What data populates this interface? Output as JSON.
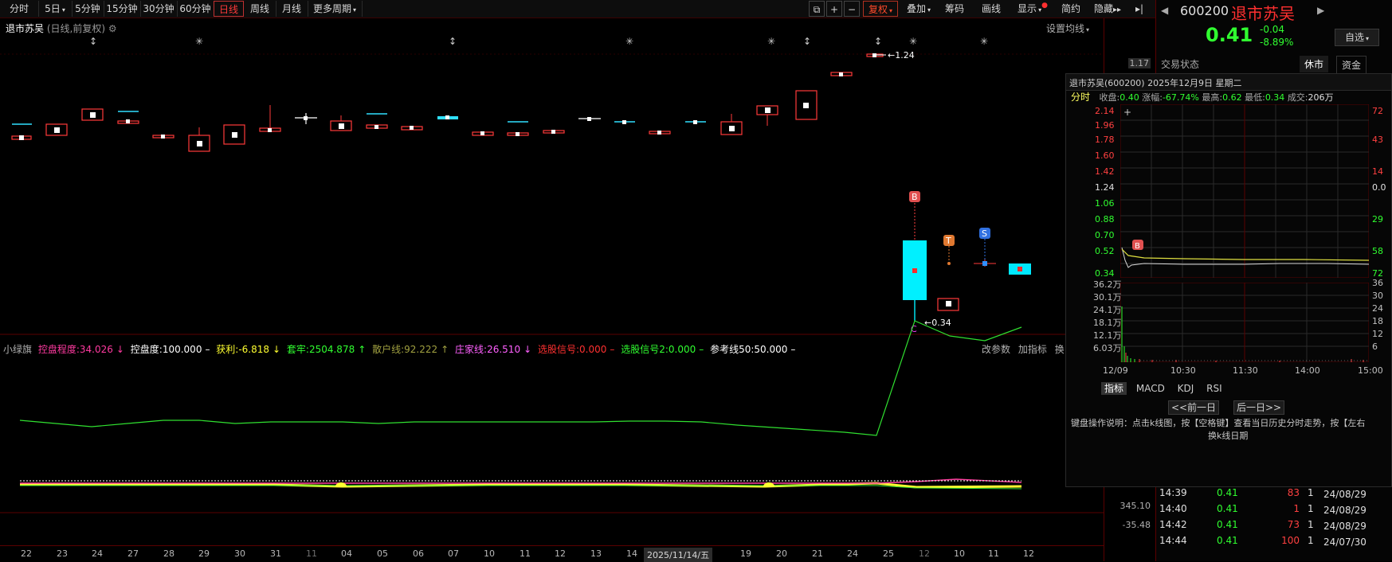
{
  "toolbar": {
    "left_items": [
      "分时",
      "5日",
      "5分钟",
      "15分钟",
      "30分钟",
      "60分钟",
      "日线",
      "周线",
      "月线",
      "更多周期"
    ],
    "right_items": [
      "复权",
      "叠加",
      "筹码",
      "画线",
      "显示",
      "简约",
      "隐藏"
    ],
    "icons": [
      "copy-window-icon",
      "plus-icon",
      "minus-icon"
    ]
  },
  "chart": {
    "stock_name": "退市苏吴",
    "subtitle": "(日线,前复权)",
    "settings_label": "设置均线",
    "price_tag_high": "1.24",
    "price_tag_low": "0.34",
    "axis_top": "1.17",
    "marker_b": "B",
    "marker_t": "T",
    "marker_s": "S",
    "marker_c": "C"
  },
  "indicator": {
    "name": "小绿旗",
    "items": [
      {
        "label": "控盘程度:34.026",
        "arrow": "↓",
        "color": "#ff3aa0"
      },
      {
        "label": "控盘度:100.000",
        "arrow": "–",
        "color": "#ffffff"
      },
      {
        "label": "获利:-6.818",
        "arrow": "↓",
        "color": "#ffff30"
      },
      {
        "label": "套牢:2504.878",
        "arrow": "↑",
        "color": "#30ff30"
      },
      {
        "label": "散户线:92.222",
        "arrow": "↑",
        "color": "#a0a040"
      },
      {
        "label": "庄家线:26.510",
        "arrow": "↓",
        "color": "#ff60ff"
      },
      {
        "label": "选股信号:0.000",
        "arrow": "–",
        "color": "#ff3030"
      },
      {
        "label": "选股信号2:0.000",
        "arrow": "–",
        "color": "#30ff30"
      },
      {
        "label": "参考线50:50.000",
        "arrow": "–",
        "color": "#ffffff"
      }
    ],
    "right_links": [
      "改参数",
      "加指标",
      "换"
    ],
    "axis_labels": [
      "345.10",
      "-35.48"
    ]
  },
  "dates": [
    "22",
    "23",
    "24",
    "27",
    "28",
    "29",
    "30",
    "31",
    "11",
    "04",
    "05",
    "06",
    "07",
    "10",
    "11",
    "12",
    "13",
    "14",
    "2025/11/14/五",
    "19",
    "20",
    "21",
    "24",
    "25",
    "12",
    "10",
    "11",
    "12"
  ],
  "quote": {
    "code": "600200",
    "name": "退市苏吴",
    "price": "0.41",
    "change": "-0.04",
    "change_pct": "-8.89%",
    "watch_label": "自选",
    "status_label": "交易状态",
    "status_value": "休市",
    "fund_label": "资金"
  },
  "popup": {
    "title": "退市苏吴(600200) 2025年12月9日 星期二",
    "tab": "分时",
    "close_label": "收盘:",
    "close_value": "0.40",
    "pct_label": "涨幅:",
    "pct_value": "-67.74%",
    "high_label": "最高:",
    "high_value": "0.62",
    "low_label": "最低:",
    "low_value": "0.34",
    "vol_label": "成交:",
    "vol_value": "206万",
    "y_left": [
      "2.14",
      "1.96",
      "1.78",
      "1.60",
      "1.42",
      "1.24",
      "1.06",
      "0.88",
      "0.70",
      "0.52",
      "0.34"
    ],
    "y_right": [
      "72",
      "58",
      "43",
      "29",
      "14",
      "0.0",
      "14",
      "29",
      "43",
      "58",
      "72"
    ],
    "vol_left": [
      "36.2万",
      "30.1万",
      "24.1万",
      "18.1万",
      "12.1万",
      "6.03万"
    ],
    "vol_right": [
      "36",
      "30",
      "24",
      "18",
      "12",
      "6"
    ],
    "x_labels": [
      "12/09",
      "10:30",
      "11:30",
      "14:00",
      "15:00"
    ],
    "sub_tabs": [
      "指标",
      "MACD",
      "KDJ",
      "RSI"
    ],
    "prev_btn": "<<前一日",
    "next_btn": "后一日>>",
    "help": "键盘操作说明：点击k线图，按【空格键】查看当日历史分时走势，按【左右",
    "help2": "换k线日期"
  },
  "ticks": [
    {
      "time": "14:39",
      "price": "0.41",
      "vol": "83",
      "n": "1",
      "date": "24/08/29"
    },
    {
      "time": "14:40",
      "price": "0.41",
      "vol": "1",
      "n": "1",
      "date": "24/08/29"
    },
    {
      "time": "14:42",
      "price": "0.41",
      "vol": "73",
      "n": "1",
      "date": "24/08/29"
    },
    {
      "time": "14:44",
      "price": "0.41",
      "vol": "100",
      "n": "1",
      "date": "24/07/30"
    }
  ]
}
